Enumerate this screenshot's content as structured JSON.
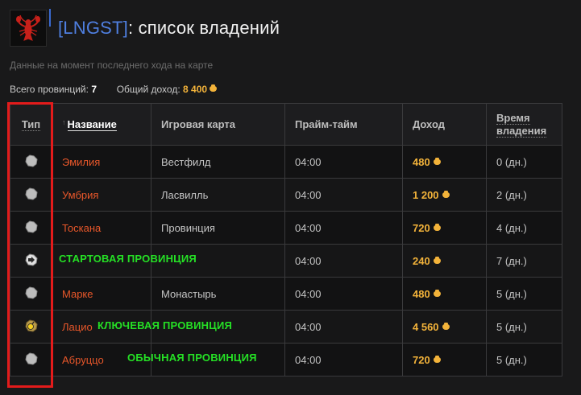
{
  "header": {
    "clan_tag": "[LNGST]",
    "title_suffix": ": список владений"
  },
  "subnote": "Данные на момент последнего хода на карте",
  "stats": {
    "total_label": "Всего провинций:",
    "total_value": "7",
    "income_label": "Общий доход:",
    "income_value": "8 400"
  },
  "columns": {
    "type": "Тип",
    "name": "Название",
    "map": "Игровая карта",
    "prime": "Прайм-тайм",
    "income": "Доход",
    "time_line1": "Время",
    "time_line2": "владения"
  },
  "rows": [
    {
      "icon": "normal-province-icon",
      "name": "Эмилия",
      "map": "Вестфилд",
      "prime": "04:00",
      "income": "480",
      "time": "0 (дн.)"
    },
    {
      "icon": "normal-province-icon",
      "name": "Умбрия",
      "map": "Ласвилль",
      "prime": "04:00",
      "income": "1 200",
      "time": "2 (дн.)"
    },
    {
      "icon": "normal-province-icon",
      "name": "Тоскана",
      "map": "Провинция",
      "prime": "04:00",
      "income": "720",
      "time": "4 (дн.)"
    },
    {
      "icon": "start-province-icon",
      "name": "",
      "map": "",
      "prime": "04:00",
      "income": "240",
      "time": "7 (дн.)"
    },
    {
      "icon": "normal-province-icon",
      "name": "Марке",
      "map": "Монастырь",
      "prime": "04:00",
      "income": "480",
      "time": "5 (дн.)"
    },
    {
      "icon": "key-province-icon",
      "name": "Лацио",
      "map": "",
      "prime": "04:00",
      "income": "4 560",
      "time": "5 (дн.)"
    },
    {
      "icon": "normal-province-icon",
      "name": "Абруццо",
      "map": "",
      "prime": "04:00",
      "income": "720",
      "time": "5 (дн.)"
    }
  ],
  "annotations": {
    "start": "СТАРТОВАЯ ПРОВИНЦИЯ",
    "key": "КЛЮЧЕВАЯ ПРОВИНЦИЯ",
    "normal": "ОБЫЧНАЯ ПРОВИНЦИЯ"
  },
  "colors": {
    "accent_blue": "#4f7fe0",
    "province_name": "#e8572a",
    "gold": "#f3b33a",
    "highlight_red": "#e31b1b",
    "annotation_green": "#25e025"
  }
}
